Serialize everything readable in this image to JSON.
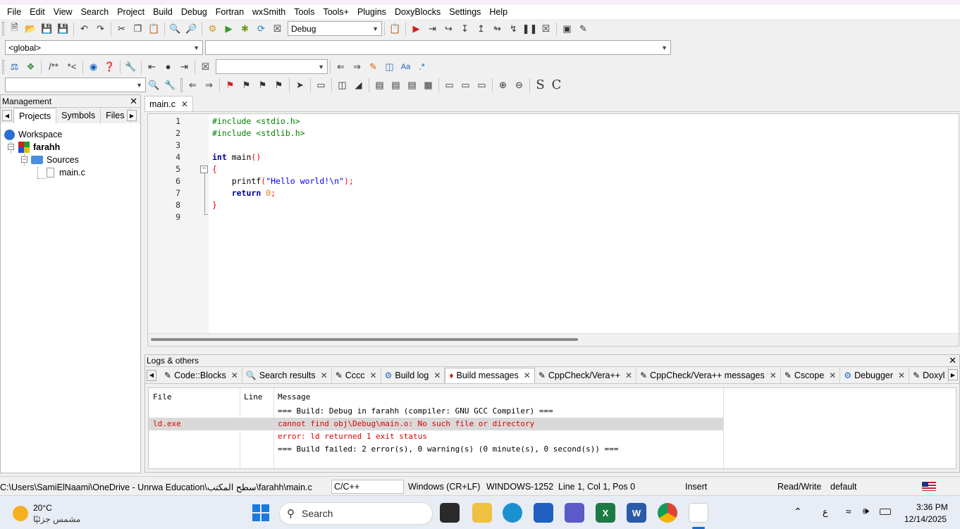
{
  "menu": [
    "File",
    "Edit",
    "View",
    "Search",
    "Project",
    "Build",
    "Debug",
    "Fortran",
    "wxSmith",
    "Tools",
    "Tools+",
    "Plugins",
    "DoxyBlocks",
    "Settings",
    "Help"
  ],
  "toolbar": {
    "build_target": "Debug",
    "scope": "<global>",
    "function": "",
    "search_combo": "",
    "comment_btn": "/**",
    "comment_line_btn": "*<",
    "bold_s": "S",
    "bold_c": "C"
  },
  "management": {
    "title": "Management",
    "tabs": [
      "Projects",
      "Symbols",
      "Files"
    ],
    "tree": {
      "workspace": "Workspace",
      "project": "farahh",
      "folder": "Sources",
      "file": "main.c"
    }
  },
  "editor": {
    "tab": "main.c",
    "line_numbers": [
      "1",
      "2",
      "3",
      "4",
      "5",
      "6",
      "7",
      "8",
      "9"
    ]
  },
  "logs": {
    "title": "Logs & others",
    "tabs": [
      "Code::Blocks",
      "Search results",
      "Cccc",
      "Build log",
      "Build messages",
      "CppCheck/Vera++",
      "CppCheck/Vera++ messages",
      "Cscope",
      "Debugger",
      "Doxyl"
    ],
    "headers": [
      "File",
      "Line",
      "Message"
    ],
    "rows": [
      {
        "file": "",
        "line": "",
        "message": "=== Build: Debug in farahh (compiler: GNU GCC Compiler) ==="
      },
      {
        "file": "ld.exe",
        "line": "",
        "message": "cannot find obj\\Debug\\main.o: No such file or directory"
      },
      {
        "file": "",
        "line": "",
        "message": "error: ld returned 1 exit status"
      },
      {
        "file": "",
        "line": "",
        "message": "=== Build failed: 2 error(s), 0 warning(s) (0 minute(s), 0 second(s)) ==="
      }
    ]
  },
  "status": {
    "path": "C:\\Users\\SamiElNaami\\OneDrive - Unrwa Education\\سطح المكتب\\farahh\\main.c",
    "language": "C/C++",
    "eol": "Windows (CR+LF)",
    "encoding": "WINDOWS-1252",
    "position": "Line 1, Col 1, Pos 0",
    "mode": "Insert",
    "access": "Read/Write",
    "profile": "default"
  },
  "taskbar": {
    "temperature": "20°C",
    "weather": "مشمس جزئيًا",
    "search_placeholder": "Search",
    "lang": "ع",
    "time": "3:36 PM",
    "date": "12/14/2025"
  },
  "colors": {
    "preprocessor": "#008000",
    "keyword": "#00009b",
    "string": "#0000ff",
    "number": "#f07800",
    "error_text": "#e00000"
  }
}
